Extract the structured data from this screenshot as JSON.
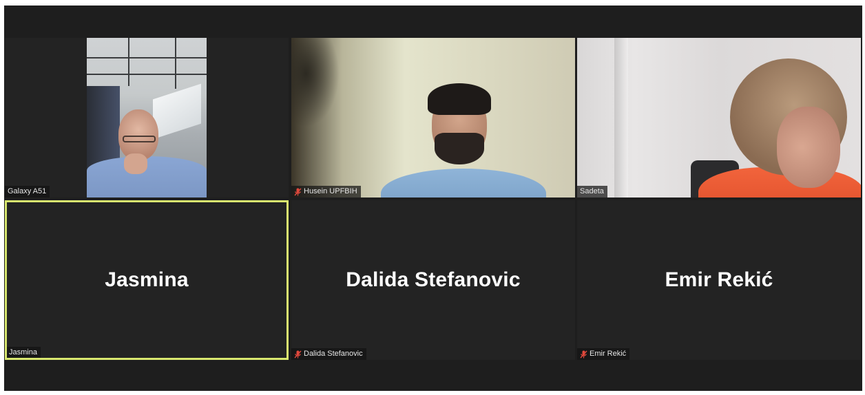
{
  "participants": [
    {
      "tag": "Galaxy A51",
      "muted": false,
      "video": true
    },
    {
      "tag": "Husein UPFBIH",
      "muted": true,
      "video": true
    },
    {
      "tag": "Sadeta",
      "muted": false,
      "video": true
    },
    {
      "tag": "Jasmina",
      "display_name": "Jasmina",
      "muted": false,
      "video": false,
      "active_speaker": true
    },
    {
      "tag": "Dalida Stefanovic",
      "display_name": "Dalida Stefanovic",
      "muted": true,
      "video": false
    },
    {
      "tag": "Emir Rekić",
      "display_name": "Emir Rekić",
      "muted": true,
      "video": false
    }
  ],
  "icons": {
    "muted": "mic-off-icon"
  },
  "colors": {
    "background": "#1e1e1e",
    "tile": "#232323",
    "active_speaker_border": "#d9e86f",
    "muted_icon": "#e0483c"
  }
}
